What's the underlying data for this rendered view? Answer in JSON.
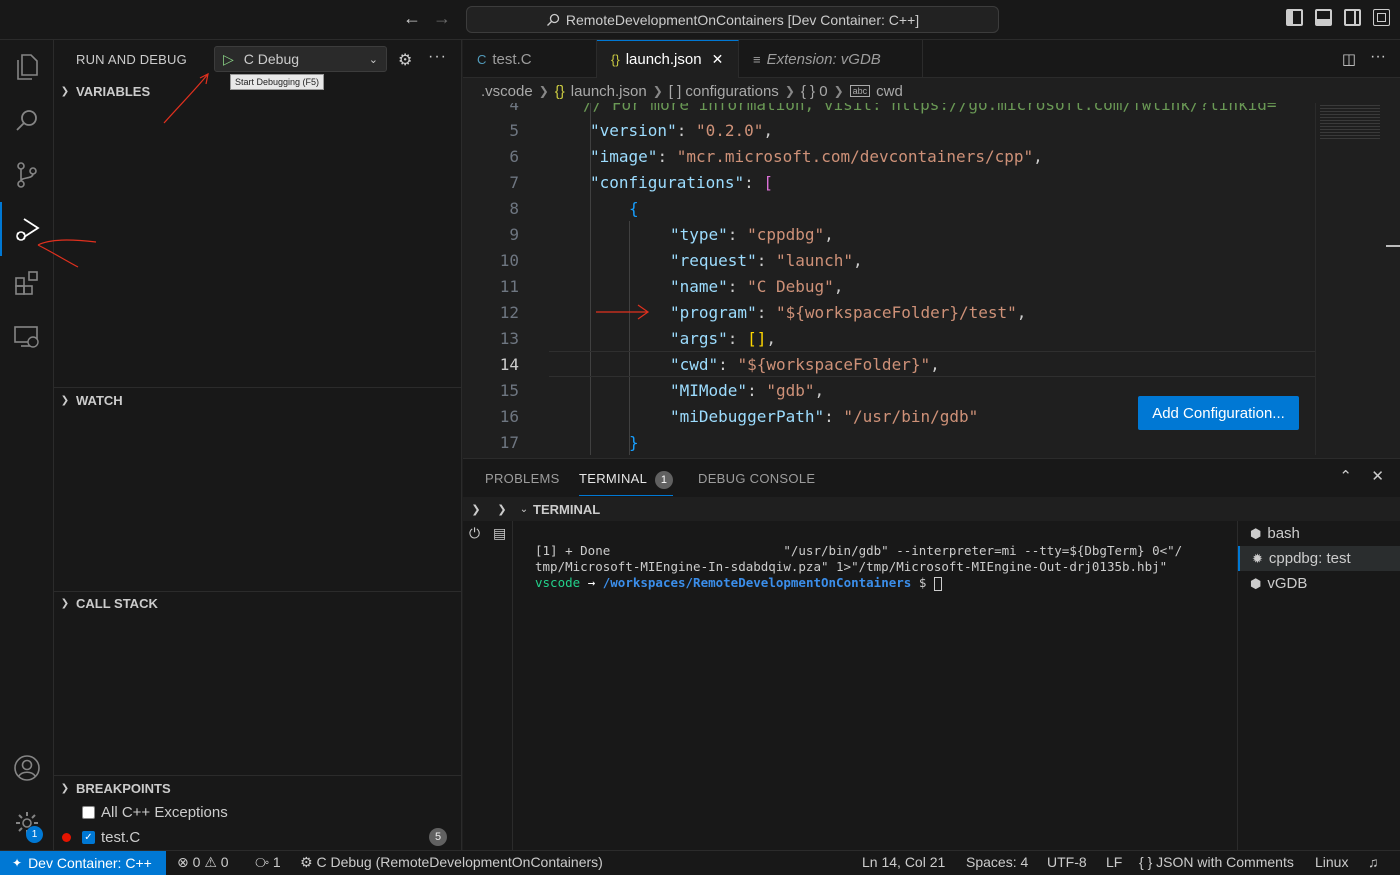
{
  "titlebar": {
    "back_icon": "arrow-left-icon",
    "forward_icon": "arrow-right-icon",
    "command_center": "RemoteDevelopmentOnContainers [Dev Container: C++]"
  },
  "sidebar": {
    "title": "RUN AND DEBUG",
    "config_selected": "C Debug",
    "tooltip": "Start Debugging (F5)",
    "sections": {
      "variables": "VARIABLES",
      "watch": "WATCH",
      "call_stack": "CALL STACK",
      "breakpoints": "BREAKPOINTS"
    },
    "breakpoints": [
      {
        "label": "All C++ Exceptions",
        "checked": false
      },
      {
        "label": "test.C",
        "checked": true,
        "count": "5"
      }
    ]
  },
  "activitybar": {
    "accounts_badge": "1"
  },
  "tabs": [
    {
      "label": "test.C",
      "icon": "c-file-icon",
      "active": false
    },
    {
      "label": "launch.json",
      "icon": "braces-icon",
      "active": true
    },
    {
      "label": "Extension: vGDB",
      "icon": "list-icon",
      "active": false
    }
  ],
  "breadcrumb": [
    ".vscode",
    "launch.json",
    "[ ] configurations",
    "{ } 0",
    "cwd"
  ],
  "editor": {
    "lines": [
      {
        "n": "4",
        "parts": [
          [
            "cmt",
            "// For more information, visit: https://go.microsoft.com/fwlink/?linkid="
          ]
        ]
      },
      {
        "n": "5",
        "parts": [
          [
            "k",
            "\"version\""
          ],
          [
            "p",
            ": "
          ],
          [
            "s",
            "\"0.2.0\""
          ],
          [
            "p",
            ","
          ]
        ]
      },
      {
        "n": "6",
        "parts": [
          [
            "k",
            "\"image\""
          ],
          [
            "p",
            ": "
          ],
          [
            "s",
            "\"mcr.microsoft.com/devcontainers/cpp\""
          ],
          [
            "p",
            ","
          ]
        ]
      },
      {
        "n": "7",
        "parts": [
          [
            "k",
            "\"configurations\""
          ],
          [
            "p",
            ": "
          ],
          [
            "br",
            "["
          ]
        ]
      },
      {
        "n": "8",
        "parts": [
          [
            "br2",
            "{"
          ]
        ]
      },
      {
        "n": "9",
        "parts": [
          [
            "k",
            "\"type\""
          ],
          [
            "p",
            ": "
          ],
          [
            "s",
            "\"cppdbg\""
          ],
          [
            "p",
            ","
          ]
        ]
      },
      {
        "n": "10",
        "parts": [
          [
            "k",
            "\"request\""
          ],
          [
            "p",
            ": "
          ],
          [
            "s",
            "\"launch\""
          ],
          [
            "p",
            ","
          ]
        ]
      },
      {
        "n": "11",
        "parts": [
          [
            "k",
            "\"name\""
          ],
          [
            "p",
            ": "
          ],
          [
            "s",
            "\"C Debug\""
          ],
          [
            "p",
            ","
          ]
        ]
      },
      {
        "n": "12",
        "parts": [
          [
            "k",
            "\"program\""
          ],
          [
            "p",
            ": "
          ],
          [
            "s",
            "\"${workspaceFolder}/test\""
          ],
          [
            "p",
            ","
          ]
        ]
      },
      {
        "n": "13",
        "parts": [
          [
            "k",
            "\"args\""
          ],
          [
            "p",
            ": "
          ],
          [
            "br3",
            "[]"
          ],
          [
            "p",
            ","
          ]
        ]
      },
      {
        "n": "14",
        "parts": [
          [
            "k",
            "\"cwd\""
          ],
          [
            "p",
            ": "
          ],
          [
            "s",
            "\"${workspaceFolder}\""
          ],
          [
            "p",
            ","
          ]
        ]
      },
      {
        "n": "15",
        "parts": [
          [
            "k",
            "\"MIMode\""
          ],
          [
            "p",
            ": "
          ],
          [
            "s",
            "\"gdb\""
          ],
          [
            "p",
            ","
          ]
        ]
      },
      {
        "n": "16",
        "parts": [
          [
            "k",
            "\"miDebuggerPath\""
          ],
          [
            "p",
            ": "
          ],
          [
            "s",
            "\"/usr/bin/gdb\""
          ]
        ]
      },
      {
        "n": "17",
        "parts": [
          [
            "br2",
            "}"
          ]
        ]
      }
    ],
    "current_line": "14",
    "add_config_label": "Add Configuration..."
  },
  "panel": {
    "tabs": [
      "PROBLEMS",
      "TERMINAL",
      "DEBUG CONSOLE"
    ],
    "terminal_badge": "1",
    "terminal_header": "TERMINAL",
    "output": {
      "line1": "[1] + Done                       \"/usr/bin/gdb\" --interpreter=mi --tty=${DbgTerm} 0<\"/",
      "line2": "tmp/Microsoft-MIEngine-In-sdabdqiw.pza\" 1>\"/tmp/Microsoft-MIEngine-Out-drj0135b.hbj\"",
      "prompt_user": "vscode",
      "prompt_arrow": "→",
      "prompt_path": "/workspaces/RemoteDevelopmentOnContainers",
      "prompt_symbol": "$"
    },
    "terminals": [
      {
        "label": "bash",
        "icon": "terminal-icon",
        "active": false
      },
      {
        "label": "cppdbg: test",
        "icon": "debug-icon",
        "active": true
      },
      {
        "label": "vGDB",
        "icon": "terminal-icon",
        "active": false
      }
    ]
  },
  "statusbar": {
    "remote": "Dev Container: C++",
    "errors": "0",
    "warnings": "0",
    "ports": "1",
    "debug_session": "C Debug (RemoteDevelopmentOnContainers)",
    "position": "Ln 14, Col 21",
    "spaces": "Spaces: 4",
    "encoding": "UTF-8",
    "eol": "LF",
    "language": "JSON with Comments",
    "os": "Linux"
  },
  "colors": {
    "accent": "#0078d4",
    "string": "#ce9178",
    "key": "#9cdcfe",
    "annotation": "#e0301e"
  }
}
